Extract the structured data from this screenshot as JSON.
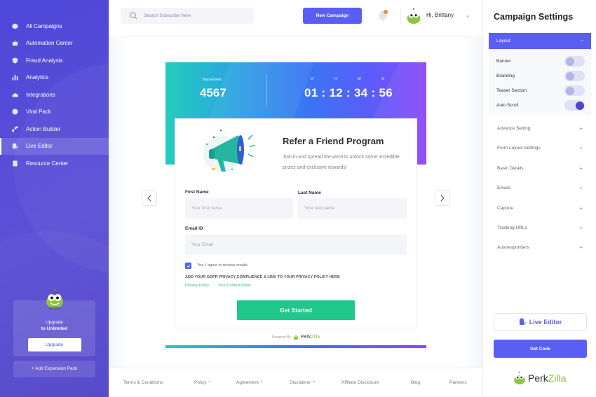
{
  "sidebar": {
    "items": [
      {
        "label": "All Campaigns",
        "icon": "cube-icon",
        "active": false
      },
      {
        "label": "Automation Center",
        "icon": "robot-icon",
        "active": false
      },
      {
        "label": "Fraud Analysis",
        "icon": "shield-icon",
        "active": false
      },
      {
        "label": "Analytics",
        "icon": "bar-chart-icon",
        "active": false
      },
      {
        "label": "Integrations",
        "icon": "cloud-icon",
        "active": false
      },
      {
        "label": "Viral Pack",
        "icon": "circle-icon",
        "active": false
      },
      {
        "label": "Action Builder",
        "icon": "puzzle-icon",
        "active": false
      },
      {
        "label": "Live Editor",
        "icon": "edit-icon",
        "active": true
      },
      {
        "label": "Resource Center",
        "icon": "book-icon",
        "active": false
      }
    ],
    "upgrade": {
      "line1": "Upgrade",
      "line2": "to Unlimited",
      "button": "Upgrade"
    },
    "expansion_button": "+ Add Expansion Pack"
  },
  "topbar": {
    "search_placeholder": "Search Subscribe Here",
    "new_campaign": "New Campaign",
    "greeting": "Hi, Brittany",
    "notification_dot_color": "#f08a3c"
  },
  "preview": {
    "total_entries_label": "Total Entries :",
    "total_entries_value": "4567",
    "timer_labels": [
      "D",
      "H",
      "M",
      "S"
    ],
    "timer": "01 : 12 : 34 : 56",
    "title": "Refer a Friend Program",
    "description": "Join in and spread the word to unlock some incredible prizes and exclusive rewards!",
    "fields": {
      "first_name_label": "First Name",
      "first_name_placeholder": "Your first name",
      "last_name_label": "Last Name",
      "last_name_placeholder": "Your last name",
      "email_label": "Email ID",
      "email_placeholder": "Your Email"
    },
    "consent_label": "Yes, I agree to recieve emails",
    "consent_checked": true,
    "gdpr_text": "ADD YOUR GDPR PRIVACY COMPLIENCE & LINK TO YOUR PRIVACY POLICY HERE",
    "links": [
      "Privacy Policy",
      "Your Contest Rules"
    ],
    "cta": "Get Started",
    "powered_by": "Powered By",
    "brand_a": "Perk",
    "brand_b": "Zilla"
  },
  "footer": {
    "items": [
      {
        "label": "Terms & Conditions",
        "caret": false
      },
      {
        "label": "Policy",
        "caret": true
      },
      {
        "label": "Agreement",
        "caret": true
      },
      {
        "label": "Disclaimer",
        "caret": true
      },
      {
        "label": "Affiliate Disclosure",
        "caret": false
      },
      {
        "label": "Blog",
        "caret": false
      },
      {
        "label": "Partners",
        "caret": false
      }
    ],
    "caret_glyph": "^"
  },
  "settings": {
    "title": "Campaign Settings",
    "layout_section": {
      "label": "Layout",
      "collapse_glyph": "−",
      "toggles": [
        {
          "label": "Banner",
          "on": false
        },
        {
          "label": "Branding",
          "on": false
        },
        {
          "label": "Teaser Section",
          "on": false
        },
        {
          "label": "Auto Scroll",
          "on": true
        }
      ]
    },
    "sections": [
      "Advance Setting",
      "From Layout Settings",
      "Basic Details",
      "Emails",
      "Capture",
      "Tracking URLs",
      "Autoresponders"
    ],
    "expand_glyph": "+",
    "live_editor_button": "Live Editor",
    "get_code_button": "Get Code",
    "brand_a": "Perk",
    "brand_b": "Zilla"
  },
  "colors": {
    "primary": "#5b5ef5",
    "sidebar": "#5048d6",
    "cta_green": "#1fc78d",
    "link_green": "#2bbf8e"
  }
}
